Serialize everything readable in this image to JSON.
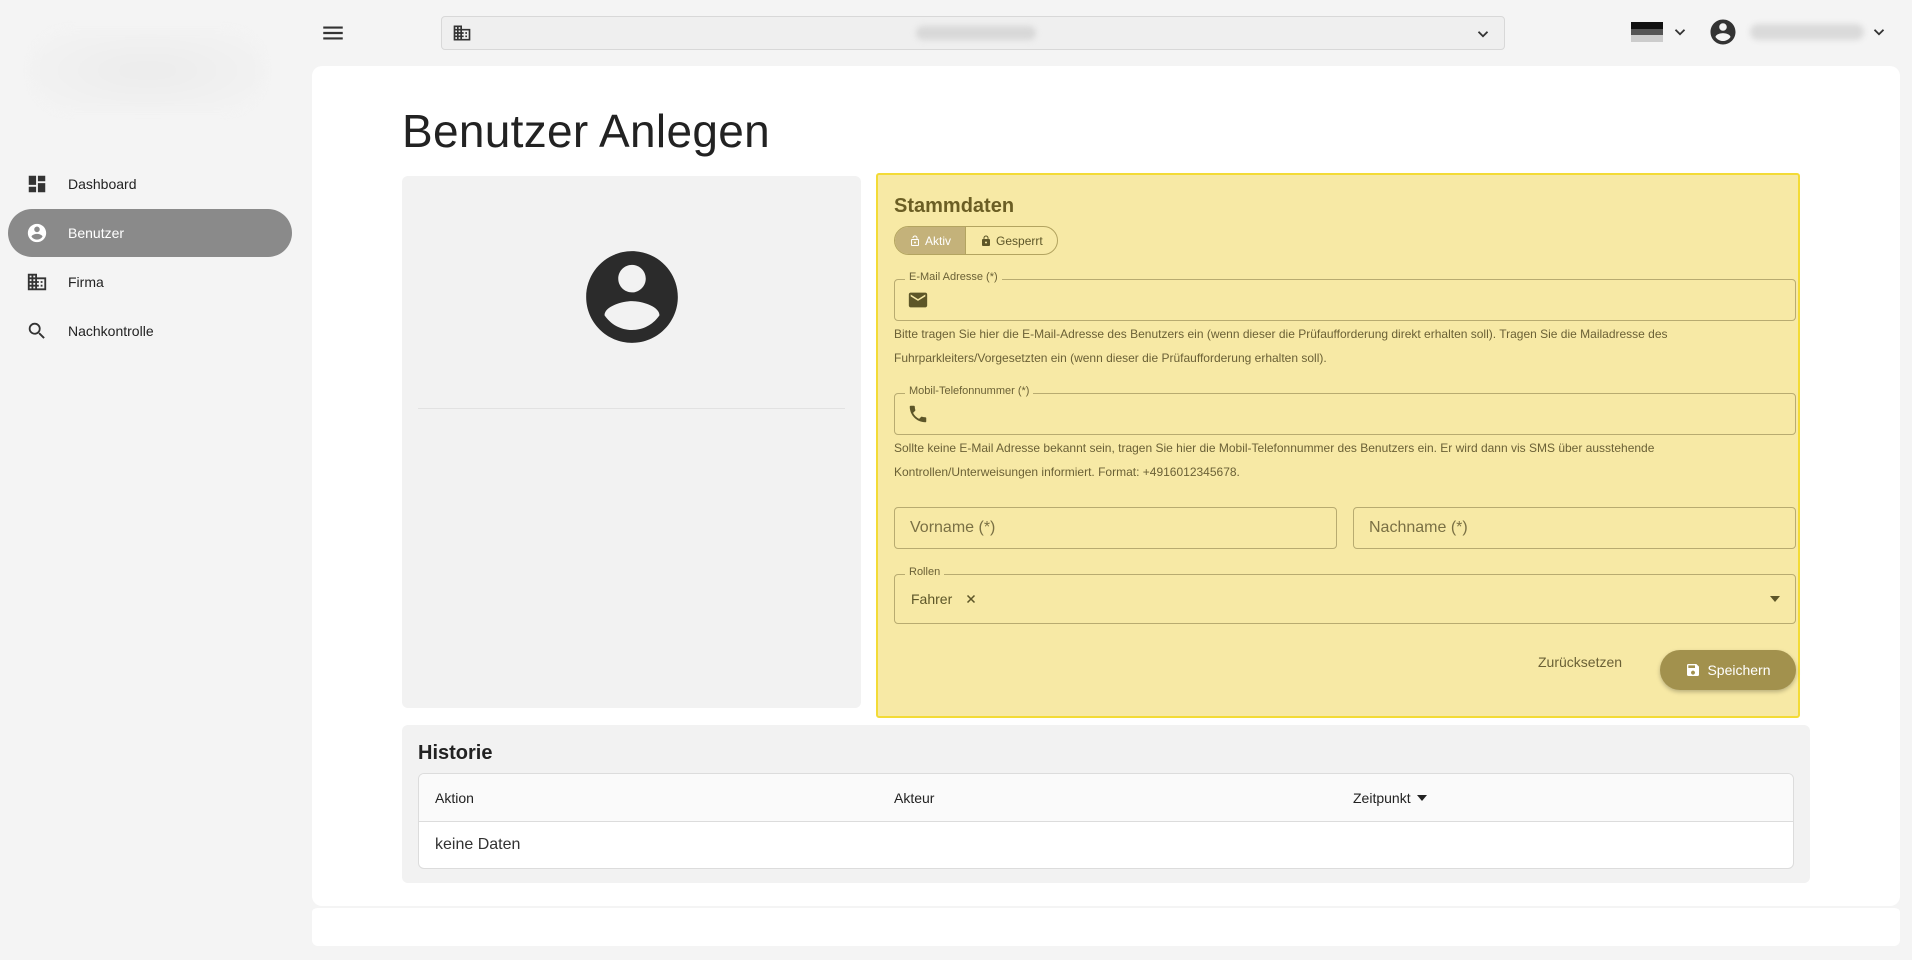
{
  "sidebar": {
    "items": [
      {
        "label": "Dashboard",
        "icon": "dashboard-icon"
      },
      {
        "label": "Benutzer",
        "icon": "account-circle-icon",
        "active": true
      },
      {
        "label": "Firma",
        "icon": "building-icon"
      },
      {
        "label": "Nachkontrolle",
        "icon": "search-icon"
      }
    ]
  },
  "topbar": {
    "menu_icon": "menu-icon",
    "company_icon": "building-icon",
    "language_flag": "german-flag",
    "user_icon": "account-circle-icon"
  },
  "page": {
    "title": "Benutzer Anlegen"
  },
  "stammdaten": {
    "title": "Stammdaten",
    "status": {
      "active_label": "Aktiv",
      "locked_label": "Gesperrt",
      "selected": "Aktiv"
    },
    "email": {
      "label": "E-Mail Adresse (*)",
      "value": "",
      "help": "Bitte tragen Sie hier die E-Mail-Adresse des Benutzers ein (wenn dieser die Prüfaufforderung direkt erhalten soll). Tragen Sie die Mailadresse des Fuhrparkleiters/Vorgesetzten ein (wenn dieser die Prüfaufforderung erhalten soll)."
    },
    "phone": {
      "label": "Mobil-Telefonnummer (*)",
      "value": "",
      "help": "Sollte keine E-Mail Adresse bekannt sein, tragen Sie hier die Mobil-Telefonnummer des Benutzers ein. Er wird dann vis SMS über ausstehende Kontrollen/Unterweisungen informiert. Format: +4916012345678."
    },
    "firstname": {
      "placeholder": "Vorname (*)"
    },
    "lastname": {
      "placeholder": "Nachname (*)"
    },
    "roles": {
      "label": "Rollen",
      "chips": [
        "Fahrer"
      ]
    },
    "reset_label": "Zurücksetzen",
    "save_label": "Speichern"
  },
  "historie": {
    "title": "Historie",
    "columns": [
      "Aktion",
      "Akteur",
      "Zeitpunkt"
    ],
    "sort_column": "Zeitpunkt",
    "empty_text": "keine Daten"
  },
  "colors": {
    "accent": "#a2914d",
    "highlight_bg": "#f7e9a5",
    "highlight_border": "#f3db36",
    "nav_active": "#8a8a8a"
  }
}
